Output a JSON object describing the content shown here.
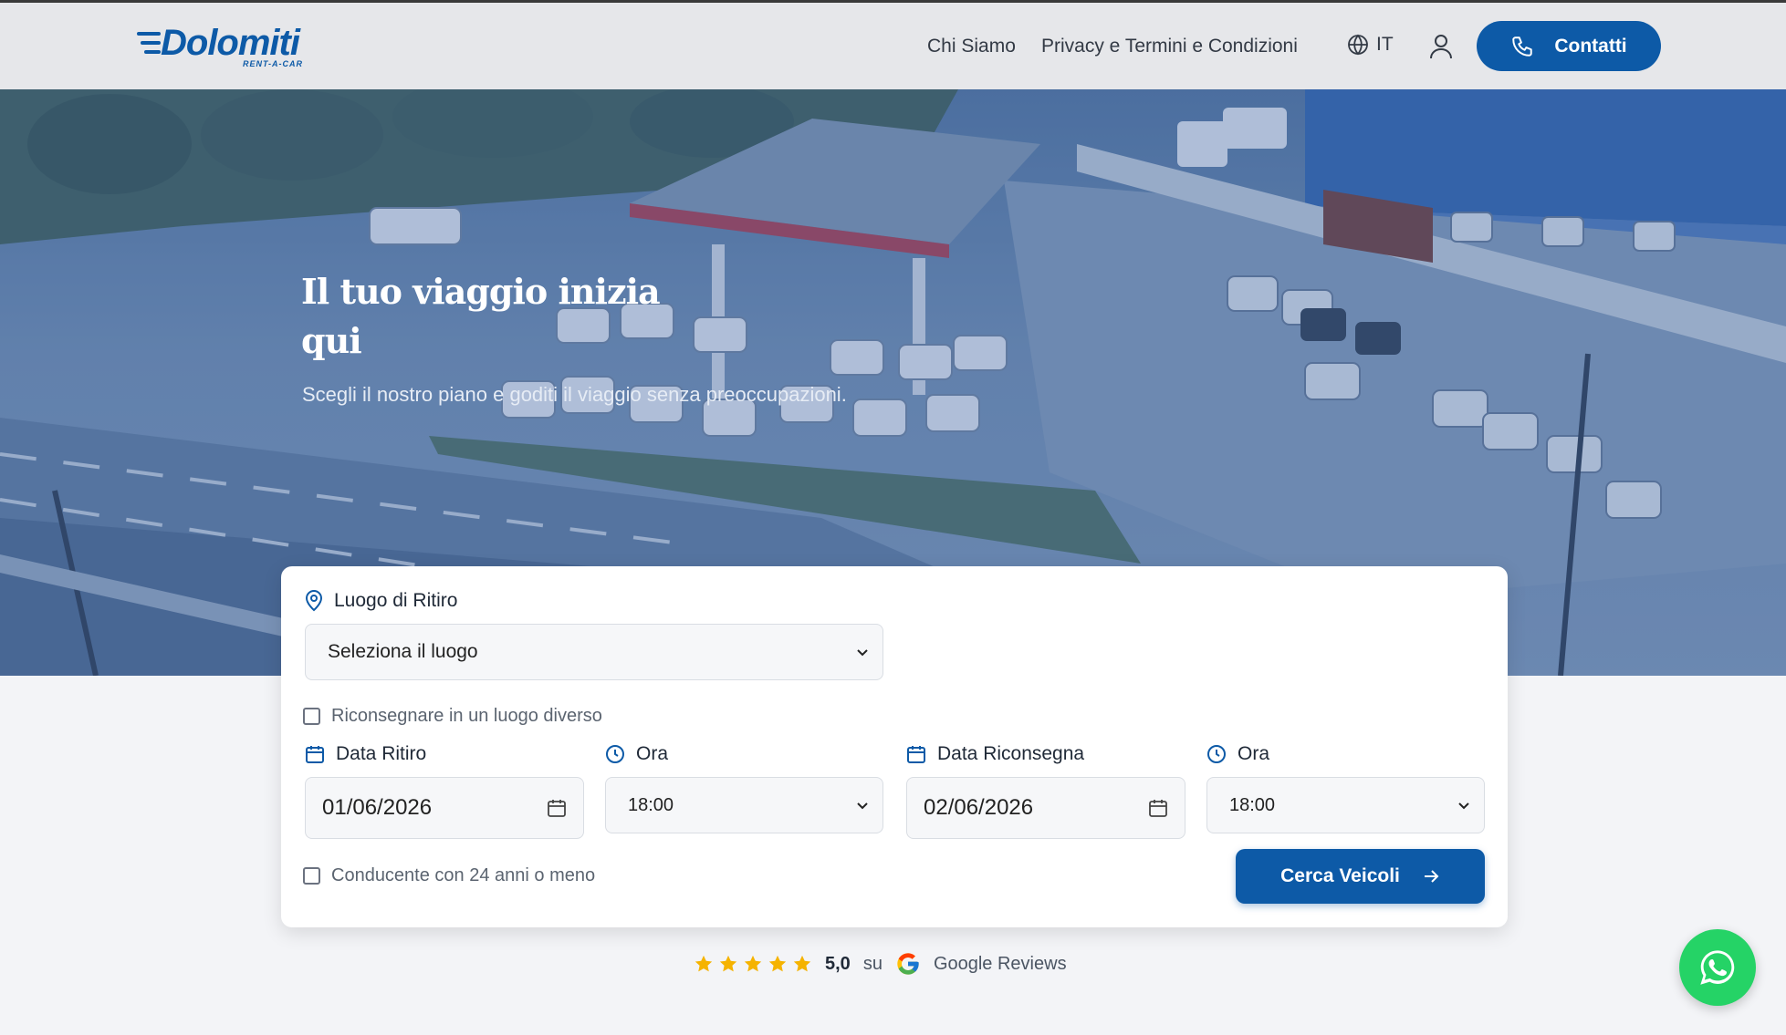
{
  "brand": {
    "name": "Dolomiti",
    "tagline": "RENT-A-CAR",
    "color": "#0d5aa7"
  },
  "nav": {
    "links": [
      "Chi Siamo",
      "Privacy e Termini e Condizioni"
    ],
    "language": "IT",
    "contact_label": "Contatti"
  },
  "hero": {
    "title": "Il tuo viaggio inizia qui",
    "subtitle": "Scegli il nostro piano e goditi il viaggio senza preoccupazioni."
  },
  "booking": {
    "pickup_location_label": "Luogo di Ritiro",
    "pickup_location_value": "Seleziona il luogo",
    "different_return_label": "Riconsegnare in un luogo diverso",
    "pickup_date_label": "Data Ritiro",
    "pickup_date_value": "01/06/2026",
    "pickup_time_label": "Ora",
    "pickup_time_value": "18:00",
    "return_date_label": "Data Riconsegna",
    "return_date_value": "02/06/2026",
    "return_time_label": "Ora",
    "return_time_value": "18:00",
    "young_driver_label": "Conducente con 24 anni o meno",
    "search_label": "Cerca Veicoli"
  },
  "reviews": {
    "stars": 5,
    "rating": "5,0",
    "su": "su",
    "source": "Google Reviews",
    "star_color": "#f5b301"
  },
  "whatsapp": {
    "icon": "whatsapp-icon",
    "color": "#25d366"
  }
}
